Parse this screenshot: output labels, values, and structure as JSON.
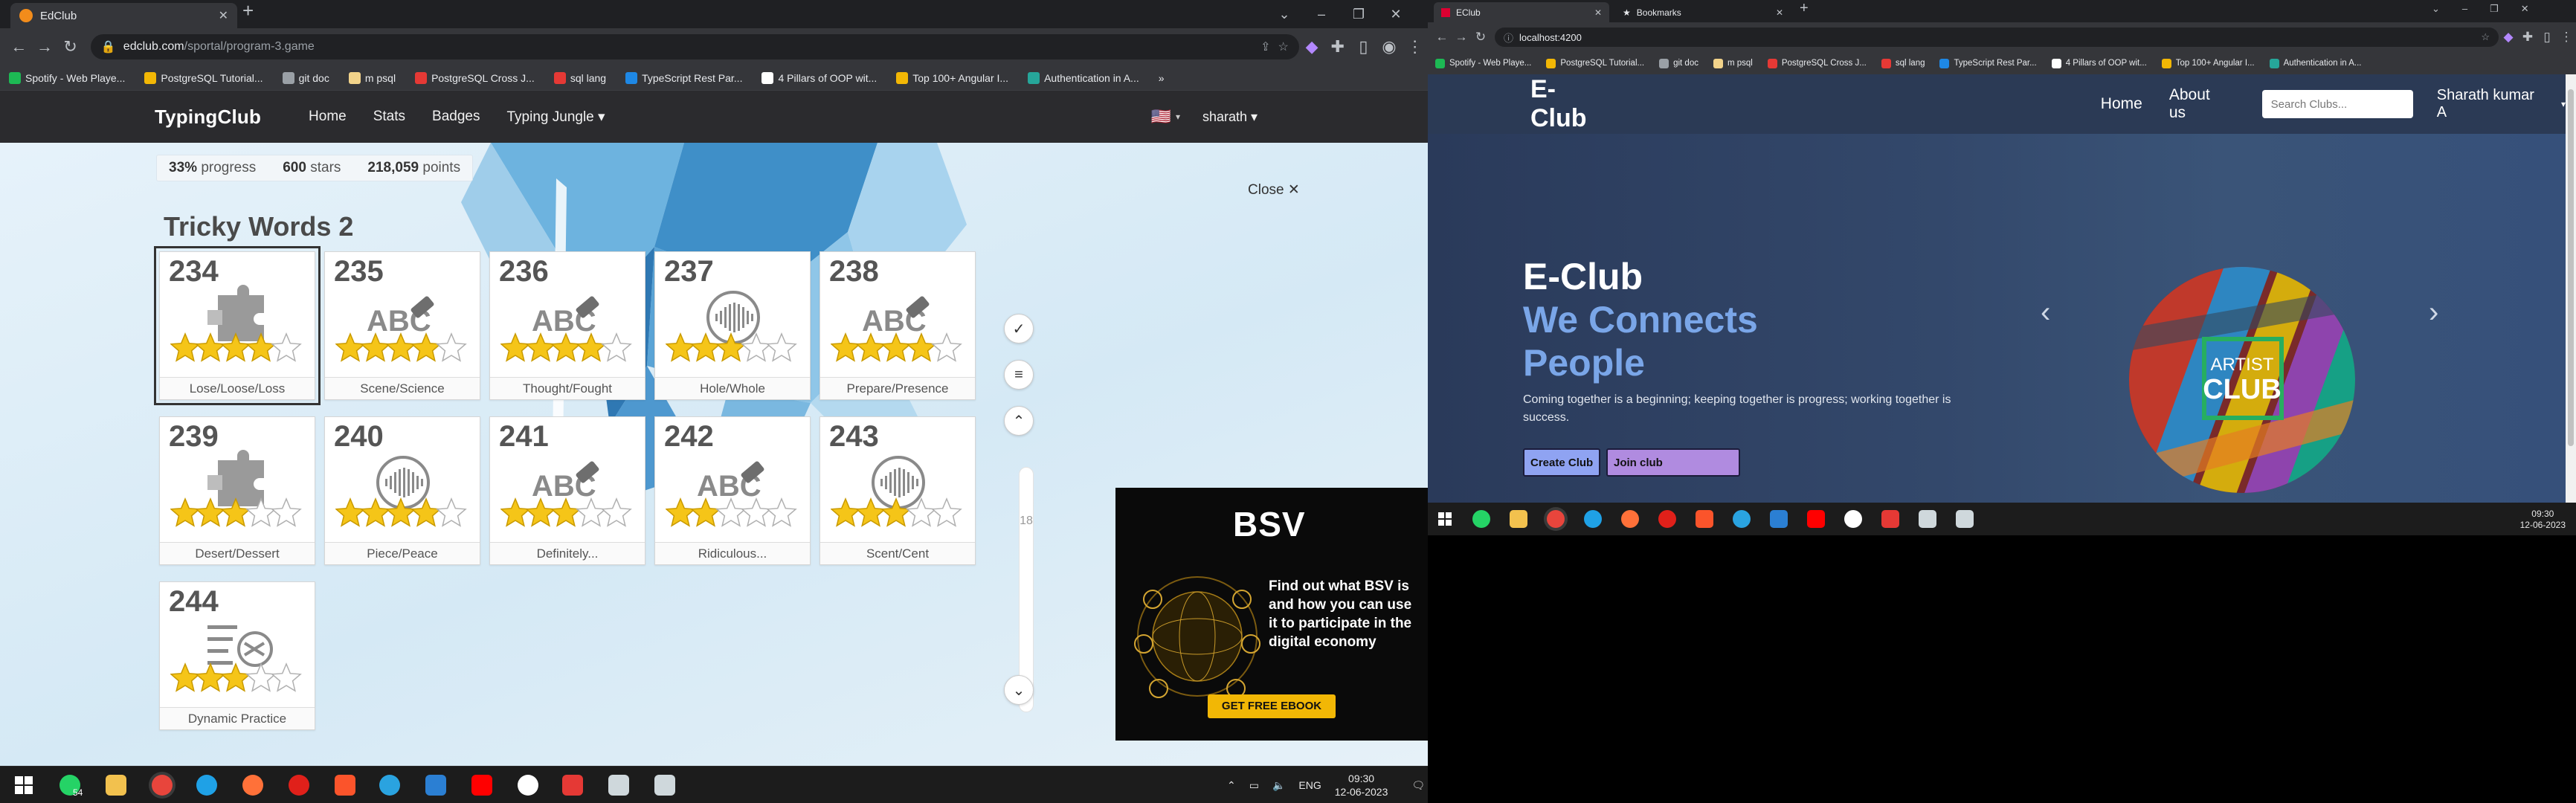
{
  "left_browser": {
    "tab": {
      "title": "EdClub"
    },
    "window_controls": [
      "⌄",
      "–",
      "❐",
      "✕"
    ],
    "url": {
      "host": "edclub.com",
      "path": "/sportal/program-3.game"
    },
    "bookmarks": [
      {
        "label": "Spotify - Web Playe...",
        "color": "#1db954"
      },
      {
        "label": "PostgreSQL Tutorial...",
        "color": "#f2b705"
      },
      {
        "label": "git doc",
        "color": "#9aa0a6"
      },
      {
        "label": "m psql",
        "color": "#f2d38a"
      },
      {
        "label": "PostgreSQL Cross J...",
        "color": "#e53935"
      },
      {
        "label": "sql lang",
        "color": "#e53935"
      },
      {
        "label": "TypeScript Rest Par...",
        "color": "#1e88e5"
      },
      {
        "label": "4 Pillars of OOP wit...",
        "color": "#ffffff"
      },
      {
        "label": "Top 100+ Angular I...",
        "color": "#f2b705"
      },
      {
        "label": "Authentication in A...",
        "color": "#26a69a"
      },
      {
        "label": "»",
        "color": "#f2b705"
      }
    ],
    "site_nav": {
      "logo": "TypingClub",
      "links": [
        "Home",
        "Stats",
        "Badges",
        "Typing Jungle ▾"
      ],
      "flag": "🇺🇸",
      "user": "sharath ▾"
    },
    "stats": {
      "progress_value": "33%",
      "progress_label": "progress",
      "stars_value": "600",
      "stars_label": "stars",
      "points_value": "218,059",
      "points_label": "points"
    },
    "close_label": "Close ✕",
    "lesson_group_title": "Tricky Words 2",
    "lessons": [
      {
        "number": "234",
        "label": "Lose/Loose/Loss",
        "icon": "puzzle-icon",
        "stars": 4
      },
      {
        "number": "235",
        "label": "Scene/Science",
        "icon": "abc-eraser-icon",
        "stars": 4
      },
      {
        "number": "236",
        "label": "Thought/Fought",
        "icon": "abc-eraser-icon",
        "stars": 4
      },
      {
        "number": "237",
        "label": "Hole/Whole",
        "icon": "audio-wave-icon",
        "stars": 3
      },
      {
        "number": "238",
        "label": "Prepare/Presence",
        "icon": "abc-eraser-icon",
        "stars": 4
      },
      {
        "number": "239",
        "label": "Desert/Dessert",
        "icon": "puzzle-icon",
        "stars": 3
      },
      {
        "number": "240",
        "label": "Piece/Peace",
        "icon": "audio-wave-icon",
        "stars": 4
      },
      {
        "number": "241",
        "label": "Definitely...",
        "icon": "abc-eraser-icon",
        "stars": 3
      },
      {
        "number": "242",
        "label": "Ridiculous...",
        "icon": "abc-eraser-icon",
        "stars": 2
      },
      {
        "number": "243",
        "label": "Scent/Cent",
        "icon": "audio-wave-icon",
        "stars": 3
      },
      {
        "number": "244",
        "label": "Dynamic Practice",
        "icon": "shuffle-list-icon",
        "stars": 3
      }
    ],
    "side_controls": {
      "check_icon": "check-circle-icon",
      "menu_icon": "menu-icon",
      "up_icon": "chevron-up-icon",
      "down_icon": "chevron-down-icon",
      "scroll_number": "18"
    },
    "ad": {
      "logo": "BSV",
      "text": "Find out what BSV is and how you can use it to participate in the digital economy",
      "cta": "GET FREE EBOOK"
    },
    "taskbar": {
      "lang": "ENG",
      "time": "09:30",
      "date": "12-06-2023",
      "badge": "54"
    }
  },
  "right_browser": {
    "tabs": [
      "EClub",
      "Bookmarks"
    ],
    "url": "localhost:4200",
    "bookmarks": [
      {
        "label": "Spotify - Web Playe...",
        "color": "#1db954"
      },
      {
        "label": "PostgreSQL Tutorial...",
        "color": "#f2b705"
      },
      {
        "label": "git doc",
        "color": "#9aa0a6"
      },
      {
        "label": "m psql",
        "color": "#f2d38a"
      },
      {
        "label": "PostgreSQL Cross J...",
        "color": "#e53935"
      },
      {
        "label": "sql lang",
        "color": "#e53935"
      },
      {
        "label": "TypeScript Rest Par...",
        "color": "#1e88e5"
      },
      {
        "label": "4 Pillars of OOP wit...",
        "color": "#ffffff"
      },
      {
        "label": "Top 100+ Angular I...",
        "color": "#f2b705"
      },
      {
        "label": "Authentication in A...",
        "color": "#26a69a"
      }
    ],
    "site_nav": {
      "logo": "E-Club",
      "links": [
        "Home",
        "About us"
      ],
      "search_placeholder": "Search Clubs...",
      "user": "Sharath kumar A"
    },
    "hero": {
      "line1": "E-Club",
      "line2": "We Connects",
      "line3": "People",
      "paragraph": "Coming together is a beginning; keeping together is progress; working together is success.",
      "btn_create": "Create Club",
      "btn_join": "Join club",
      "club_image_text1": "ARTIST",
      "club_image_text2": "CLUB",
      "prev_icon": "chevron-left-icon",
      "next_icon": "chevron-right-icon"
    },
    "taskbar": {
      "time": "09:30",
      "date": "12-06-2023"
    }
  },
  "colors": {
    "hero_blue": "#7aa6e8",
    "create_btn": "#8fa3f2",
    "join_btn": "#b08be0",
    "star": "#f5c518",
    "ad_cta": "#f2b705"
  }
}
